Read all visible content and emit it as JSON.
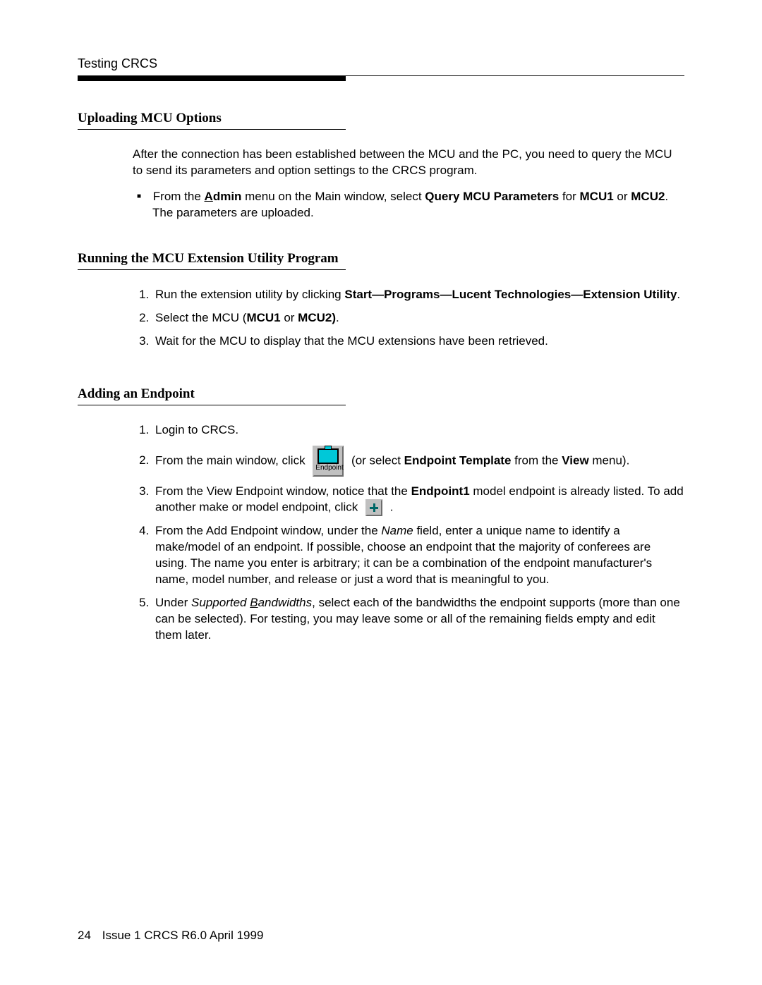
{
  "header": {
    "title": "Testing CRCS"
  },
  "sections": {
    "s1": {
      "heading": "Uploading MCU Options",
      "para": "After the connection has been established between the MCU and the PC, you need to query the MCU to send its parameters and option settings to the CRCS program.",
      "bullet_pre": "From the ",
      "bullet_admin_a": "A",
      "bullet_admin_rest": "dmin",
      "bullet_mid": " menu on the Main window, select ",
      "bullet_bold1": "Query MCU Parameters",
      "bullet_for": " for ",
      "bullet_mcu1": "MCU1",
      "bullet_or": " or ",
      "bullet_mcu2": "MCU2",
      "bullet_tail": ". The parameters are uploaded."
    },
    "s2": {
      "heading": "Running the MCU Extension Utility Program",
      "li1_pre": "Run the extension utility by clicking ",
      "li1_start": "Start",
      "li1_sep": "—",
      "li1_programs": "Programs",
      "li1_lucent": "Lucent Technologies",
      "li1_ext": "Extension Utility",
      "li1_dot": ".",
      "li2_pre": "Select the MCU (",
      "li2_mcu1": "MCU1",
      "li2_or": " or ",
      "li2_mcu2": "MCU2)",
      "li2_dot": ".",
      "li3": "Wait for the MCU to display that the MCU extensions have been retrieved."
    },
    "s3": {
      "heading": "Adding an Endpoint",
      "li1": "Login to CRCS.",
      "li2_pre": "From the main window, click ",
      "li2_mid": " (or select ",
      "li2_bold": "Endpoint Template",
      "li2_post": " from the ",
      "li2_view": "View",
      "li2_tail": " menu).",
      "endpoint_icon_label": "Endpoint",
      "li3_pre": "From the View Endpoint window, notice that the ",
      "li3_bold": "Endpoint1",
      "li3_post": " model endpoint is already listed. To add another make or model endpoint, click ",
      "li3_dot": " .",
      "li4_pre": "From the Add Endpoint window, under the ",
      "li4_name": "Name",
      "li4_post": " field, enter a unique name to identify a make/model of an endpoint. If possible, choose an endpoint that the majority of conferees are using. The name you enter is arbitrary; it can be a combination of the endpoint manufacturer's name, model number, and release or just a word that is meaningful to you.",
      "li5_pre": "Under ",
      "li5_sup": "Supported ",
      "li5_b": "B",
      "li5_bandrest": "andwidths",
      "li5_post": ", select each of the bandwidths the endpoint supports (more than one can be selected). For testing, you may leave some or all of the remaining fields empty and edit them later."
    }
  },
  "footer": {
    "page": "24",
    "text": "Issue 1 CRCS R6.0  April 1999"
  }
}
